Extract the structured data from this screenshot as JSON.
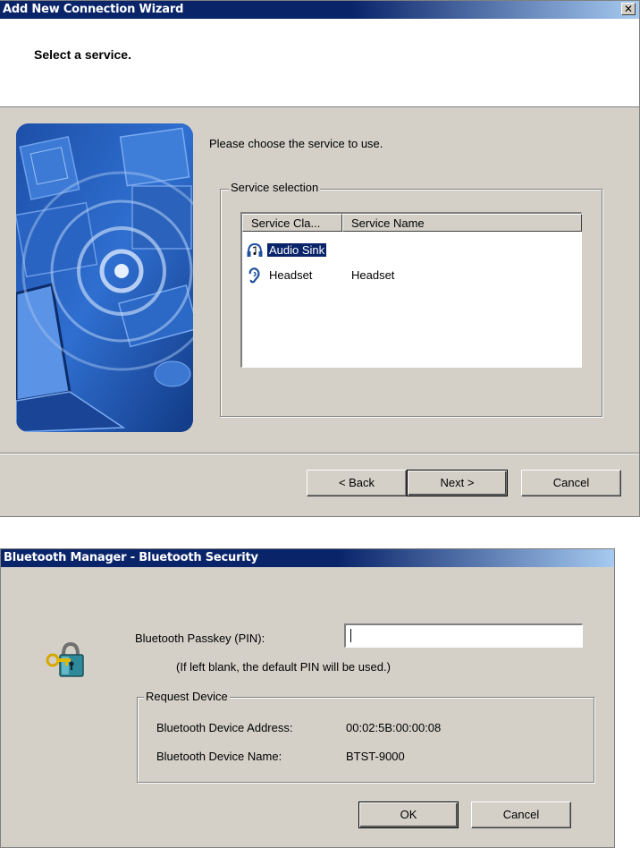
{
  "wizard": {
    "title": "Add New Connection Wizard",
    "heading": "Select a service.",
    "prompt": "Please choose the service to use.",
    "group_label": "Service selection",
    "columns": [
      "Service Cla...",
      "Service Name"
    ],
    "rows": [
      {
        "service_class": "Audio Sink",
        "service_name": "",
        "icon": "headphones-icon",
        "selected": true
      },
      {
        "service_class": "Headset",
        "service_name": "Headset",
        "icon": "ear-icon",
        "selected": false
      }
    ],
    "buttons": {
      "back": "< Back",
      "next": "Next >",
      "cancel": "Cancel"
    }
  },
  "bt_dialog": {
    "title": "Bluetooth Manager - Bluetooth Security",
    "passkey_label": "Bluetooth Passkey (PIN):",
    "passkey_value": "",
    "hint": "(If left blank, the default PIN will be used.)",
    "group_label": "Request Device",
    "address_label": "Bluetooth Device Address:",
    "address_value": "00:02:5B:00:00:08",
    "name_label": "Bluetooth Device Name:",
    "name_value": "BTST-9000",
    "buttons": {
      "ok": "OK",
      "cancel": "Cancel"
    },
    "icon": "lock-key-icon"
  },
  "colors": {
    "titlebar": "#0a246a",
    "face": "#d4d0c8",
    "selection": "#0a246a"
  }
}
